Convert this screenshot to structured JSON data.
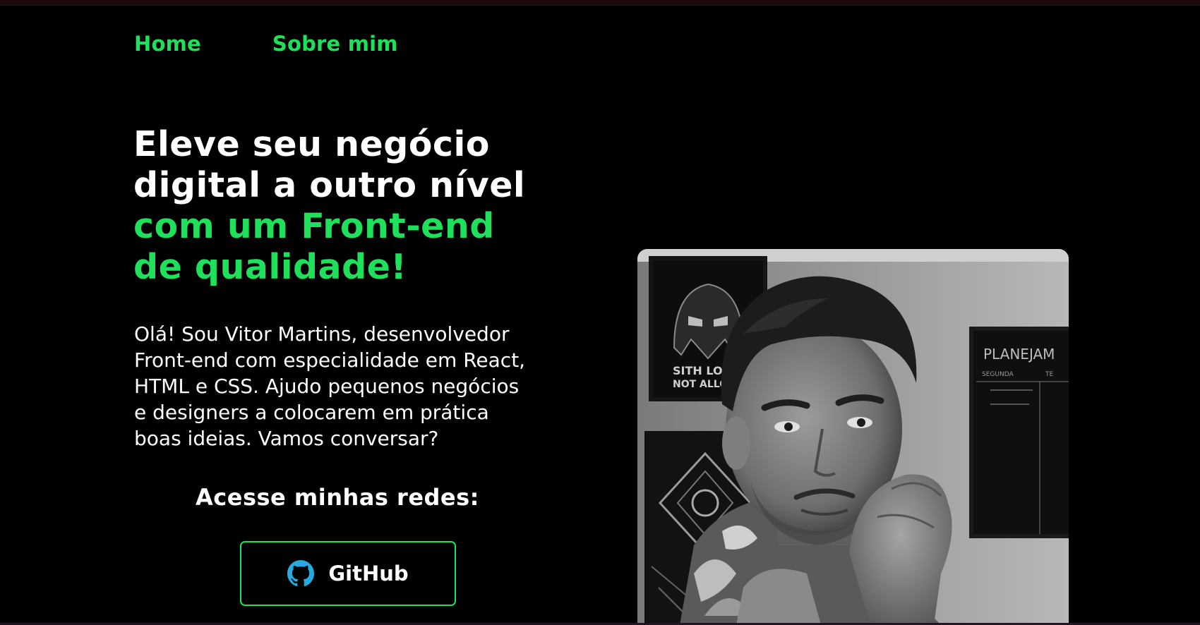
{
  "nav": {
    "items": [
      {
        "label": "Home"
      },
      {
        "label": "Sobre mim"
      }
    ]
  },
  "hero": {
    "headline_white": [
      "Eleve seu negócio",
      "digital a outro nível"
    ],
    "headline_green": [
      "com um Front-end",
      "de qualidade!"
    ],
    "intro": [
      "Olá! Sou Vitor Martins, desenvolvedor",
      "Front-end com especialidade em React,",
      "HTML e CSS. Ajudo pequenos negócios",
      "e designers a colocarem em prática",
      "boas ideias. Vamos conversar?"
    ],
    "networks_title": "Acesse minhas redes:",
    "github_label": "GitHub"
  },
  "photo": {
    "poster_text": [
      "SITH LO",
      "NOT ALLOW"
    ],
    "board_title": "PLANEJAM",
    "board_cols": [
      "SEGUNDA",
      "TE"
    ]
  },
  "colors": {
    "accent": "#1fe05a",
    "background": "#000000",
    "text": "#ffffff",
    "github_icon": "#27a9e1"
  }
}
